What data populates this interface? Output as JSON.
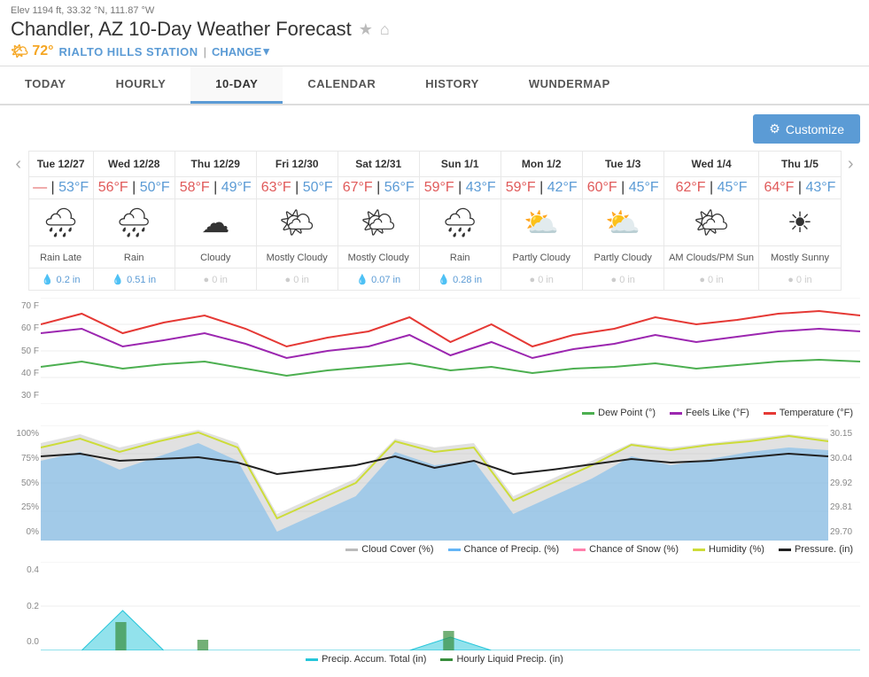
{
  "header": {
    "elev": "Elev 1194 ft, 33.32 °N, 111.87 °W",
    "title": "Chandler, AZ 10-Day Weather Forecast",
    "temp": "72°",
    "station": "RIALTO HILLS STATION",
    "change": "CHANGE"
  },
  "tabs": [
    {
      "label": "TODAY",
      "active": false
    },
    {
      "label": "HOURLY",
      "active": false
    },
    {
      "label": "10-DAY",
      "active": true
    },
    {
      "label": "CALENDAR",
      "active": false
    },
    {
      "label": "HISTORY",
      "active": false
    },
    {
      "label": "WUNDERMAP",
      "active": false
    }
  ],
  "toolbar": {
    "customize_label": "Customize"
  },
  "days": [
    {
      "date": "Tue 12/27",
      "high": "53°F",
      "low": "—",
      "icon": "🌧",
      "condition": "Rain Late",
      "precip": "0.2 in"
    },
    {
      "date": "Wed 12/28",
      "high": "56°F",
      "low": "50°F",
      "icon": "🌧",
      "condition": "Rain",
      "precip": "0.51 in"
    },
    {
      "date": "Thu 12/29",
      "high": "58°F",
      "low": "49°F",
      "icon": "☁",
      "condition": "Cloudy",
      "precip": "0 in"
    },
    {
      "date": "Fri 12/30",
      "high": "63°F",
      "low": "50°F",
      "icon": "🌤",
      "condition": "Mostly Cloudy",
      "precip": "0 in"
    },
    {
      "date": "Sat 12/31",
      "high": "67°F",
      "low": "56°F",
      "icon": "🌤",
      "condition": "Mostly Cloudy",
      "precip": "0.07 in"
    },
    {
      "date": "Sun 1/1",
      "high": "59°F",
      "low": "43°F",
      "icon": "🌧",
      "condition": "Rain",
      "precip": "0.28 in"
    },
    {
      "date": "Mon 1/2",
      "high": "59°F",
      "low": "42°F",
      "icon": "⛅",
      "condition": "Partly Cloudy",
      "precip": "0 in"
    },
    {
      "date": "Tue 1/3",
      "high": "60°F",
      "low": "45°F",
      "icon": "⛅",
      "condition": "Partly Cloudy",
      "precip": "0 in"
    },
    {
      "date": "Wed 1/4",
      "high": "62°F",
      "low": "45°F",
      "icon": "🌤",
      "condition": "AM Clouds/PM Sun",
      "precip": "0 in"
    },
    {
      "date": "Thu 1/5",
      "high": "64°F",
      "low": "43°F",
      "icon": "☀",
      "condition": "Mostly Sunny",
      "precip": "0 in"
    }
  ],
  "temp_chart": {
    "y_labels": [
      "70 F",
      "60 F",
      "50 F",
      "40 F",
      "30 F"
    ]
  },
  "temp_legend": [
    {
      "label": "Dew Point (°)",
      "color": "green"
    },
    {
      "label": "Feels Like (°F)",
      "color": "purple"
    },
    {
      "label": "Temperature (°F)",
      "color": "red"
    }
  ],
  "cloud_chart": {
    "y_labels_left": [
      "100%",
      "75%",
      "50%",
      "25%",
      "0%"
    ],
    "y_labels_right": [
      "30.15",
      "30.04",
      "29.92",
      "29.81",
      "29.70"
    ]
  },
  "cloud_legend": [
    {
      "label": "Cloud Cover (%)",
      "color": "gray"
    },
    {
      "label": "Chance of Precip. (%)",
      "color": "blue"
    },
    {
      "label": "Chance of Snow (%)",
      "color": "pink"
    },
    {
      "label": "Humidity (%)",
      "color": "lime"
    },
    {
      "label": "Pressure. (in)",
      "color": "black"
    }
  ],
  "precip_legend": [
    {
      "label": "Precip. Accum. Total (in)",
      "color": "teal"
    },
    {
      "label": "Hourly Liquid Precip. (in)",
      "color": "darkgreen"
    }
  ],
  "precip_chart": {
    "y_labels": [
      "0.4",
      "0.2",
      "0.0"
    ]
  }
}
